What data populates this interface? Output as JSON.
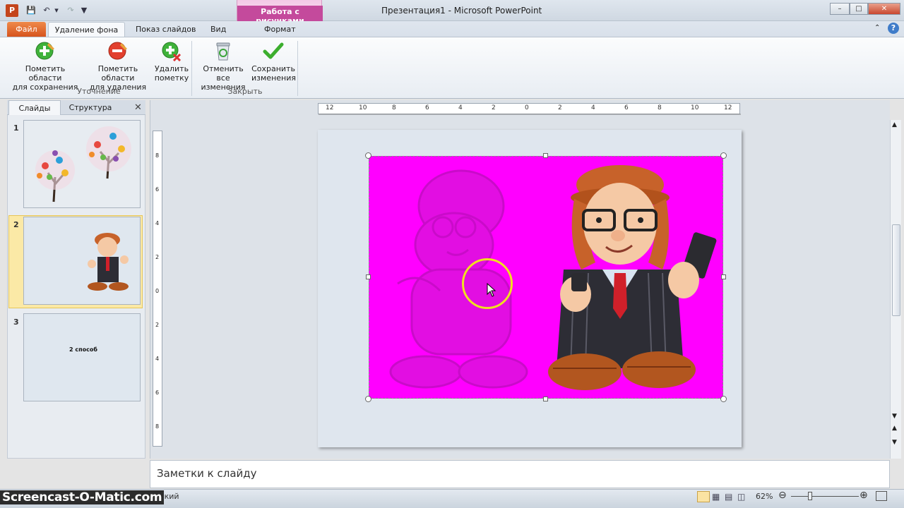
{
  "window": {
    "title": "Презентация1  -  Microsoft PowerPoint",
    "app_icon_letter": "P",
    "context_tab_group": "Работа с рисунками"
  },
  "tabs": {
    "file": "Файл",
    "remove_background": "Удаление фона",
    "slideshow": "Показ слайдов",
    "view": "Вид",
    "format": "Формат"
  },
  "ribbon": {
    "mark_keep_line1": "Пометить области",
    "mark_keep_line2": "для сохранения",
    "mark_remove_line1": "Пометить области",
    "mark_remove_line2": "для удаления",
    "delete_mark_line1": "Удалить",
    "delete_mark_line2": "пометку",
    "group_refine": "Уточнение",
    "discard_line1": "Отменить все",
    "discard_line2": "изменения",
    "keep_line1": "Сохранить",
    "keep_line2": "изменения",
    "group_close": "Закрыть"
  },
  "left_pane": {
    "tab_slides": "Слайды",
    "tab_outline": "Структура",
    "slides": [
      {
        "num": "1"
      },
      {
        "num": "2"
      },
      {
        "num": "3",
        "text": "2 способ"
      }
    ]
  },
  "ruler": {
    "h_labels": [
      "12",
      "10",
      "8",
      "6",
      "4",
      "2",
      "0",
      "2",
      "4",
      "6",
      "8",
      "10",
      "12"
    ],
    "v_labels": [
      "8",
      "6",
      "4",
      "2",
      "0",
      "2",
      "4",
      "6",
      "8"
    ]
  },
  "notes": {
    "placeholder": "Заметки к слайду"
  },
  "status": {
    "language": "усский",
    "zoom": "62%",
    "watermark": "Screencast-O-Matic.com"
  },
  "colors": {
    "removal_overlay": "#ff00ff",
    "file_tab": "#d6541e",
    "context_accent": "#c44a9c",
    "selected_slide": "#fbe9a6"
  }
}
